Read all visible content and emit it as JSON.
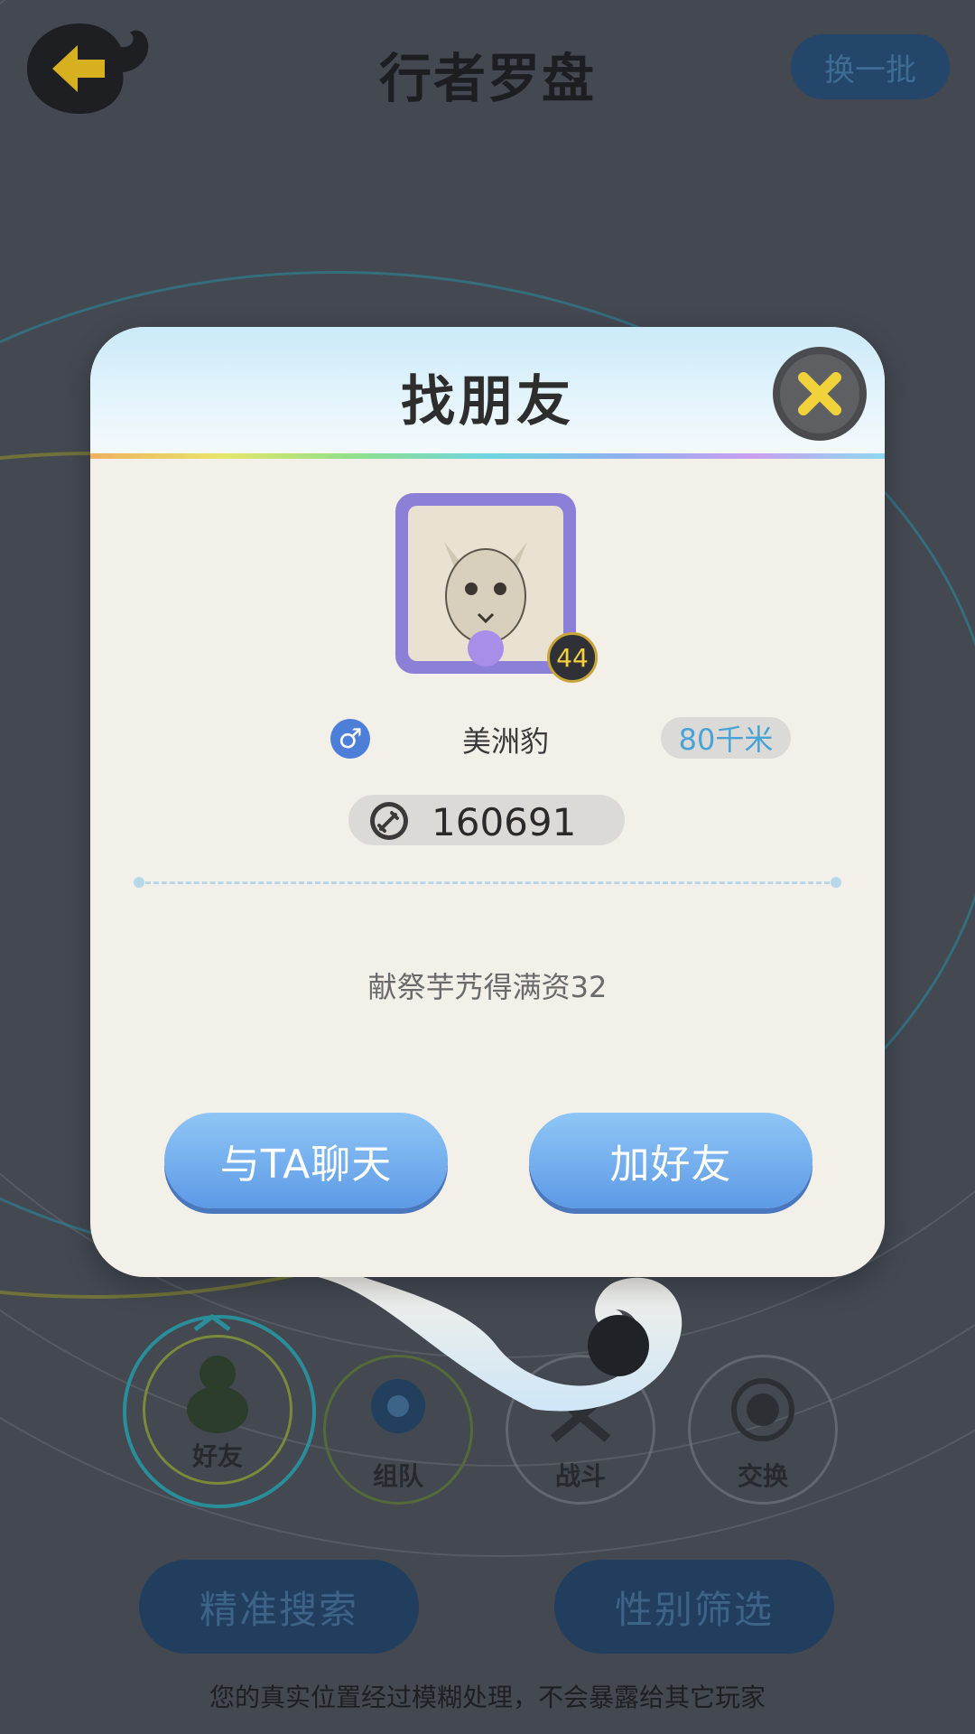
{
  "header": {
    "title": "行者罗盘",
    "refresh_label": "换一批"
  },
  "nav": [
    {
      "label": "好友"
    },
    {
      "label": "组队"
    },
    {
      "label": "战斗"
    },
    {
      "label": "交换"
    }
  ],
  "bottom": {
    "precise_search_label": "精准搜索",
    "gender_filter_label": "性别筛选",
    "footnote": "您的真实位置经过模糊处理，不会暴露给其它玩家"
  },
  "dialog": {
    "title": "找朋友",
    "level": "44",
    "gender_symbol": "♂",
    "nickname": "美洲豹",
    "distance": "80千米",
    "power": "160691",
    "signature": "献祭芋艿得满资32",
    "chat_label": "与TA聊天",
    "add_friend_label": "加好友"
  },
  "colors": {
    "accent_blue": "#5d9ae6",
    "close_yellow": "#f2d23a",
    "distance_text": "#4aa3d6"
  }
}
